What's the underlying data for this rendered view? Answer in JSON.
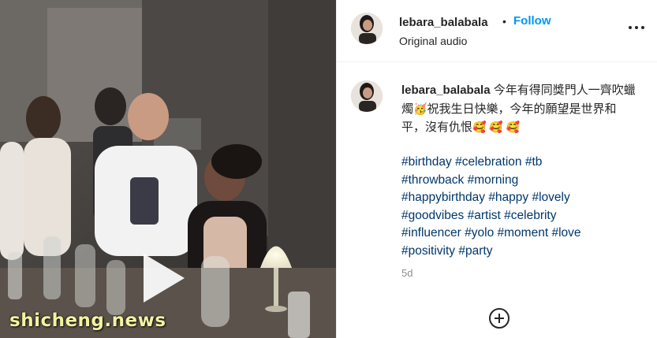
{
  "post": {
    "username": "lebara_balabala",
    "separator": "•",
    "follow_label": "Follow",
    "audio": "Original audio",
    "caption_user": "lebara_balabala",
    "caption_text_1": " 今年有得同獎門人一齊吹蠟燭",
    "caption_emoji_1": "🥳",
    "caption_text_2": "祝我生日快樂，今年的願望是世界和平，沒有仇恨",
    "caption_emoji_2": "🥰 🥰 🥰",
    "hashtags": [
      "#birthday",
      "#celebration",
      "#tb",
      "#throwback",
      "#morning",
      "#happybirthday",
      "#happy",
      "#lovely",
      "#goodvibes",
      "#artist",
      "#celebrity",
      "#influencer",
      "#yolo",
      "#moment",
      "#love",
      "#positivity",
      "#party"
    ],
    "hashtag_lines": [
      3,
      2,
      3,
      3,
      4,
      2
    ],
    "time_ago": "5d"
  },
  "media": {
    "watermark": "shicheng.news"
  },
  "icons": {
    "more": "more-options-icon",
    "play": "play-icon",
    "add": "add-circle-icon"
  },
  "colors": {
    "follow": "#0095f6",
    "hashtag": "#00376b",
    "muted": "#8e8e8e"
  }
}
